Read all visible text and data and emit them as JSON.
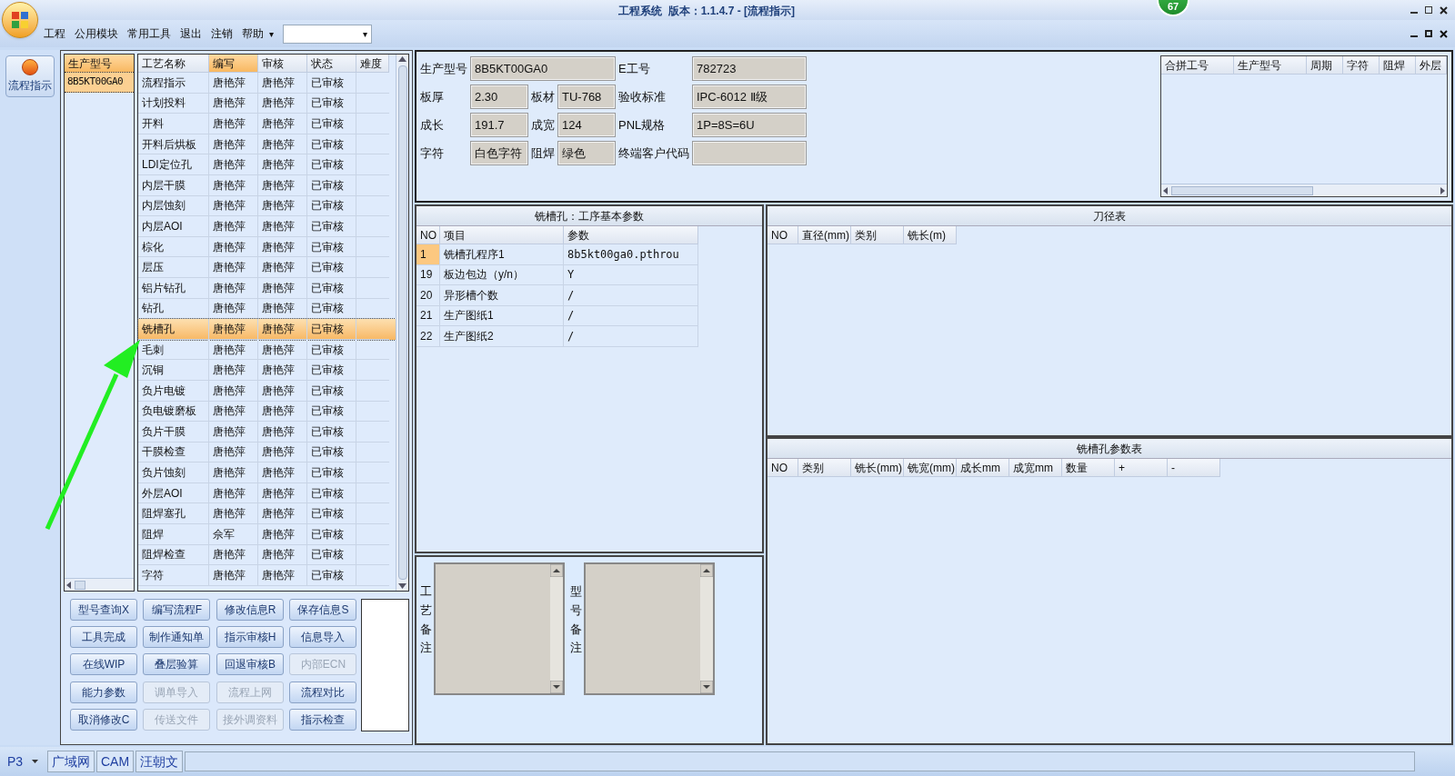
{
  "window": {
    "title": "工程系统  版本：1.1.4.7 - [流程指示]",
    "badge": "67"
  },
  "menu": {
    "items": [
      "工程",
      "公用模块",
      "常用工具",
      "退出",
      "注销",
      "帮助"
    ],
    "overflow": "▾",
    "combo_arrow": "▾"
  },
  "nav": {
    "button": "流程指示"
  },
  "models": {
    "header": "生产型号",
    "items": [
      {
        "label": "8B5KT00GA0",
        "selected": true
      }
    ]
  },
  "process_table": {
    "columns": [
      {
        "label": "工艺名称",
        "selected": false
      },
      {
        "label": "编写",
        "selected": true
      },
      {
        "label": "审核",
        "selected": false
      },
      {
        "label": "状态",
        "selected": false
      },
      {
        "label": "难度",
        "selected": false
      }
    ],
    "rows": [
      {
        "cells": [
          "流程指示",
          "唐艳萍",
          "唐艳萍",
          "已审核"
        ],
        "selected": false
      },
      {
        "cells": [
          "计划投料",
          "唐艳萍",
          "唐艳萍",
          "已审核"
        ],
        "selected": false
      },
      {
        "cells": [
          "开料",
          "唐艳萍",
          "唐艳萍",
          "已审核"
        ],
        "selected": false
      },
      {
        "cells": [
          "开料后烘板",
          "唐艳萍",
          "唐艳萍",
          "已审核"
        ],
        "selected": false
      },
      {
        "cells": [
          "LDI定位孔",
          "唐艳萍",
          "唐艳萍",
          "已审核"
        ],
        "selected": false
      },
      {
        "cells": [
          "内层干膜",
          "唐艳萍",
          "唐艳萍",
          "已审核"
        ],
        "selected": false
      },
      {
        "cells": [
          "内层蚀刻",
          "唐艳萍",
          "唐艳萍",
          "已审核"
        ],
        "selected": false
      },
      {
        "cells": [
          "内层AOI",
          "唐艳萍",
          "唐艳萍",
          "已审核"
        ],
        "selected": false
      },
      {
        "cells": [
          "棕化",
          "唐艳萍",
          "唐艳萍",
          "已审核"
        ],
        "selected": false
      },
      {
        "cells": [
          "层压",
          "唐艳萍",
          "唐艳萍",
          "已审核"
        ],
        "selected": false
      },
      {
        "cells": [
          "铝片钻孔",
          "唐艳萍",
          "唐艳萍",
          "已审核"
        ],
        "selected": false
      },
      {
        "cells": [
          "钻孔",
          "唐艳萍",
          "唐艳萍",
          "已审核"
        ],
        "selected": false
      },
      {
        "cells": [
          "铣槽孔",
          "唐艳萍",
          "唐艳萍",
          "已审核"
        ],
        "selected": true
      },
      {
        "cells": [
          "毛刺",
          "唐艳萍",
          "唐艳萍",
          "已审核"
        ],
        "selected": false
      },
      {
        "cells": [
          "沉铜",
          "唐艳萍",
          "唐艳萍",
          "已审核"
        ],
        "selected": false
      },
      {
        "cells": [
          "负片电镀",
          "唐艳萍",
          "唐艳萍",
          "已审核"
        ],
        "selected": false
      },
      {
        "cells": [
          "负电镀磨板",
          "唐艳萍",
          "唐艳萍",
          "已审核"
        ],
        "selected": false
      },
      {
        "cells": [
          "负片干膜",
          "唐艳萍",
          "唐艳萍",
          "已审核"
        ],
        "selected": false
      },
      {
        "cells": [
          "干膜检查",
          "唐艳萍",
          "唐艳萍",
          "已审核"
        ],
        "selected": false
      },
      {
        "cells": [
          "负片蚀刻",
          "唐艳萍",
          "唐艳萍",
          "已审核"
        ],
        "selected": false
      },
      {
        "cells": [
          "外层AOI",
          "唐艳萍",
          "唐艳萍",
          "已审核"
        ],
        "selected": false
      },
      {
        "cells": [
          "阻焊塞孔",
          "唐艳萍",
          "唐艳萍",
          "已审核"
        ],
        "selected": false
      },
      {
        "cells": [
          "阻焊",
          "佘军",
          "唐艳萍",
          "已审核"
        ],
        "selected": false
      },
      {
        "cells": [
          "阻焊检查",
          "唐艳萍",
          "唐艳萍",
          "已审核"
        ],
        "selected": false
      },
      {
        "cells": [
          "字符",
          "唐艳萍",
          "唐艳萍",
          "已审核"
        ],
        "selected": false
      }
    ]
  },
  "buttons": [
    {
      "label": "型号查询X",
      "disabled": false
    },
    {
      "label": "编写流程F",
      "disabled": false
    },
    {
      "label": "修改信息R",
      "disabled": false
    },
    {
      "label": "保存信息S",
      "disabled": false
    },
    {
      "label": "工具完成",
      "disabled": false
    },
    {
      "label": "制作通知单",
      "disabled": false
    },
    {
      "label": "指示审核H",
      "disabled": false
    },
    {
      "label": "信息导入",
      "disabled": false
    },
    {
      "label": "在线WIP",
      "disabled": false
    },
    {
      "label": "叠层验算",
      "disabled": false
    },
    {
      "label": "回退审核B",
      "disabled": false
    },
    {
      "label": "内部ECN",
      "disabled": true
    },
    {
      "label": "能力参数",
      "disabled": false
    },
    {
      "label": "调单导入",
      "disabled": true
    },
    {
      "label": "流程上网",
      "disabled": true
    },
    {
      "label": "流程对比",
      "disabled": false
    },
    {
      "label": "取消修改C",
      "disabled": false
    },
    {
      "label": "传送文件",
      "disabled": true
    },
    {
      "label": "接外调资料",
      "disabled": true
    },
    {
      "label": "指示检查",
      "disabled": false
    }
  ],
  "info": {
    "rows": [
      [
        {
          "label": "生产型号",
          "value": "8B5KT00GA0"
        },
        "",
        {
          "label": "E工号",
          "value": "782723"
        }
      ],
      [
        {
          "label": "板厚",
          "value": "2.30"
        },
        {
          "label": "板材",
          "value": "TU-768"
        },
        {
          "label": "验收标准",
          "value": "IPC-6012 Ⅱ级"
        }
      ],
      [
        {
          "label": "成长",
          "value": "191.7"
        },
        {
          "label": "成宽",
          "value": "124"
        },
        {
          "label": "PNL规格",
          "value": "1P=8S=6U"
        }
      ],
      [
        {
          "label": "字符",
          "value": "白色字符"
        },
        {
          "label": "阻焊",
          "value": "绿色"
        },
        {
          "label": "终端客户代码"
        }
      ]
    ]
  },
  "merge_table": {
    "columns": [
      "合拼工号",
      "生产型号",
      "周期",
      "字符",
      "阻焊",
      "外层"
    ]
  },
  "params_panel": {
    "title": "铣槽孔：工序基本参数",
    "columns": [
      "NO",
      "项目",
      "参数"
    ],
    "rows": [
      {
        "cells": [
          "1",
          "铣槽孔程序1",
          "8b5kt00ga0.pthrou"
        ],
        "selected": true
      },
      {
        "cells": [
          "19",
          "板边包边（y/n）",
          "Y"
        ],
        "selected": false
      },
      {
        "cells": [
          "20",
          "异形槽个数",
          "/"
        ],
        "selected": false
      },
      {
        "cells": [
          "21",
          "生产图纸1",
          "/"
        ],
        "selected": false
      },
      {
        "cells": [
          "22",
          "生产图纸2",
          "/"
        ],
        "selected": false
      }
    ]
  },
  "tool_table": {
    "title": "刀径表",
    "columns": [
      "NO",
      "直径(mm)",
      "类别",
      "铣长(m)"
    ]
  },
  "slot_table": {
    "title": "铣槽孔参数表",
    "columns": [
      "NO",
      "类别",
      "铣长(mm)",
      "铣宽(mm)",
      "成长mm",
      "成宽mm",
      "数量",
      "+",
      "-"
    ]
  },
  "notes": [
    {
      "label": "工艺备注"
    },
    {
      "label": "型号备注"
    }
  ],
  "status_bar": {
    "selector": "P3",
    "tabs": [
      "广域网",
      "CAM",
      "汪朝文"
    ]
  }
}
